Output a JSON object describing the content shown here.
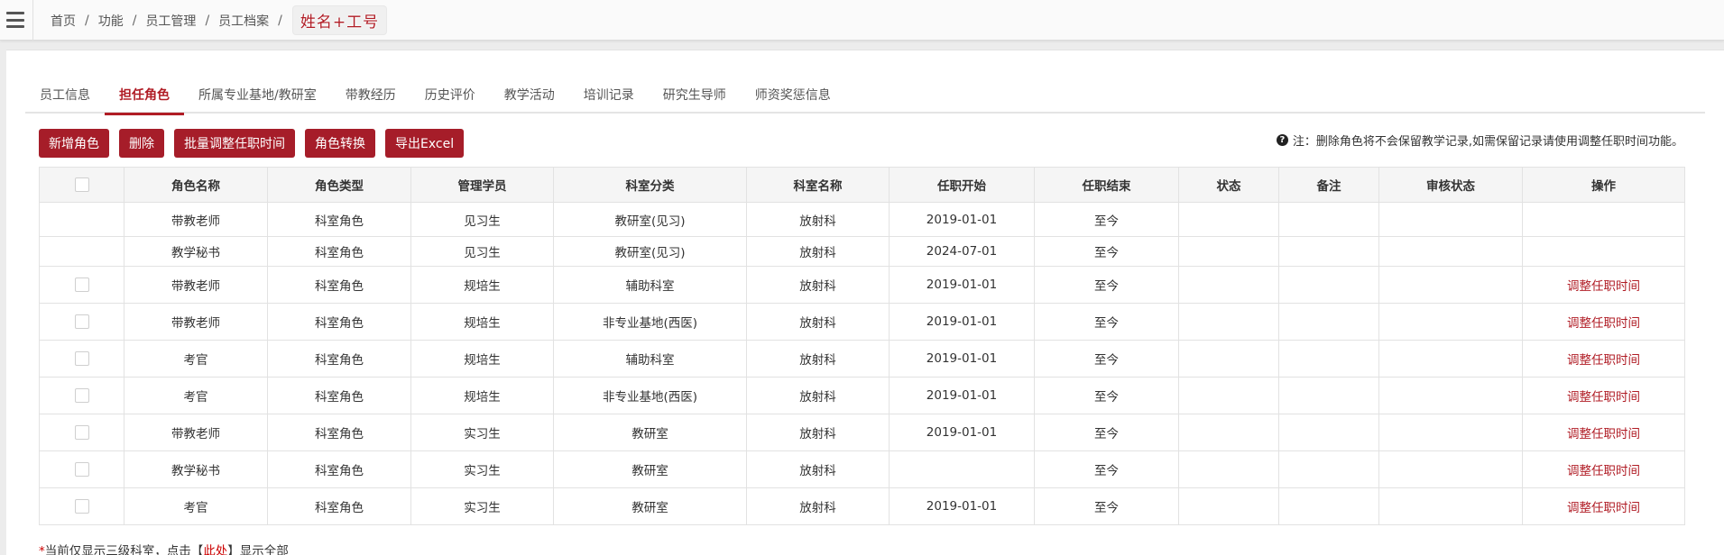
{
  "breadcrumb": {
    "items": [
      "首页",
      "功能",
      "员工管理",
      "员工档案"
    ],
    "separator": "/",
    "current": "姓名+工号"
  },
  "tabs": [
    {
      "label": "员工信息",
      "active": false
    },
    {
      "label": "担任角色",
      "active": true
    },
    {
      "label": "所属专业基地/教研室",
      "active": false
    },
    {
      "label": "带教经历",
      "active": false
    },
    {
      "label": "历史评价",
      "active": false
    },
    {
      "label": "教学活动",
      "active": false
    },
    {
      "label": "培训记录",
      "active": false
    },
    {
      "label": "研究生导师",
      "active": false
    },
    {
      "label": "师资奖惩信息",
      "active": false
    }
  ],
  "toolbar": {
    "add": "新增角色",
    "delete": "删除",
    "batch_adjust": "批量调整任职时间",
    "convert": "角色转换",
    "export": "导出Excel"
  },
  "note": "注：删除角色将不会保留教学记录,如需保留记录请使用调整任职时间功能。",
  "table": {
    "columns": [
      "",
      "角色名称",
      "角色类型",
      "管理学员",
      "科室分类",
      "科室名称",
      "任职开始",
      "任职结束",
      "状态",
      "备注",
      "审核状态",
      "操作"
    ],
    "rows": [
      {
        "checkbox": false,
        "role": "带教老师",
        "type": "科室角色",
        "student": "见习生",
        "category": "教研室(见习)",
        "dept": "放射科",
        "start": "2019-01-01",
        "end": "至今",
        "status": "",
        "remark": "",
        "audit": "",
        "action": ""
      },
      {
        "checkbox": false,
        "role": "教学秘书",
        "type": "科室角色",
        "student": "见习生",
        "category": "教研室(见习)",
        "dept": "放射科",
        "start": "2024-07-01",
        "end": "至今",
        "status": "",
        "remark": "",
        "audit": "",
        "action": ""
      },
      {
        "checkbox": true,
        "role": "带教老师",
        "type": "科室角色",
        "student": "规培生",
        "category": "辅助科室",
        "dept": "放射科",
        "start": "2019-01-01",
        "end": "至今",
        "status": "",
        "remark": "",
        "audit": "",
        "action": "调整任职时间"
      },
      {
        "checkbox": true,
        "role": "带教老师",
        "type": "科室角色",
        "student": "规培生",
        "category": "非专业基地(西医)",
        "dept": "放射科",
        "start": "2019-01-01",
        "end": "至今",
        "status": "",
        "remark": "",
        "audit": "",
        "action": "调整任职时间"
      },
      {
        "checkbox": true,
        "role": "考官",
        "type": "科室角色",
        "student": "规培生",
        "category": "辅助科室",
        "dept": "放射科",
        "start": "2019-01-01",
        "end": "至今",
        "status": "",
        "remark": "",
        "audit": "",
        "action": "调整任职时间"
      },
      {
        "checkbox": true,
        "role": "考官",
        "type": "科室角色",
        "student": "规培生",
        "category": "非专业基地(西医)",
        "dept": "放射科",
        "start": "2019-01-01",
        "end": "至今",
        "status": "",
        "remark": "",
        "audit": "",
        "action": "调整任职时间"
      },
      {
        "checkbox": true,
        "role": "带教老师",
        "type": "科室角色",
        "student": "实习生",
        "category": "教研室",
        "dept": "放射科",
        "start": "2019-01-01",
        "end": "至今",
        "status": "",
        "remark": "",
        "audit": "",
        "action": "调整任职时间"
      },
      {
        "checkbox": true,
        "role": "教学秘书",
        "type": "科室角色",
        "student": "实习生",
        "category": "教研室",
        "dept": "放射科",
        "start": "",
        "end": "至今",
        "status": "",
        "remark": "",
        "audit": "",
        "action": "调整任职时间"
      },
      {
        "checkbox": true,
        "role": "考官",
        "type": "科室角色",
        "student": "实习生",
        "category": "教研室",
        "dept": "放射科",
        "start": "2019-01-01",
        "end": "至今",
        "status": "",
        "remark": "",
        "audit": "",
        "action": "调整任职时间"
      }
    ]
  },
  "footnote": {
    "star": "*",
    "prefix": "当前仅显示三级科室，点击【",
    "link": "此处",
    "suffix": "】显示全部"
  },
  "colors": {
    "accent": "#a61d29",
    "link": "#b01c25",
    "header_bg": "#f5f5f5"
  },
  "icons": [
    "menu-icon",
    "question-circle-icon",
    "checkbox"
  ]
}
